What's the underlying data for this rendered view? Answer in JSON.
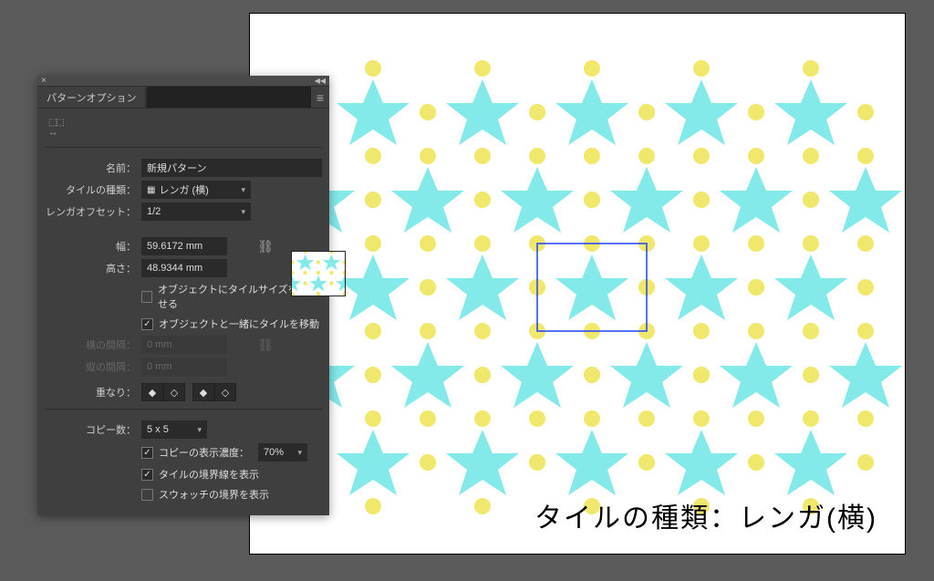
{
  "panel": {
    "title": "パターンオプション",
    "name_label": "名前：",
    "name_value": "新規パターン",
    "tiletype_label": "タイルの種類：",
    "tiletype_value": "レンガ (横)",
    "offset_label": "レンガオフセット：",
    "offset_value": "1/2",
    "width_label": "幅：",
    "width_value": "59.6172 mm",
    "height_label": "高さ：",
    "height_value": "48.9344 mm",
    "chk_size_label": "オブジェクトにタイルサイズを合わせる",
    "chk_move_label": "オブジェクトと一緒にタイルを移動",
    "hspacing_label": "横の間隔：",
    "hspacing_value": "0 mm",
    "vspacing_label": "縦の間隔：",
    "vspacing_value": "0 mm",
    "overlap_label": "重なり：",
    "copies_label": "コピー数：",
    "copies_value": "5 x 5",
    "dim_label": "コピーの表示濃度：",
    "dim_value": "70%",
    "chk_tileedge_label": "タイルの境界線を表示",
    "chk_swatch_label": "スウォッチの境界を表示"
  },
  "canvas": {
    "caption": "タイルの種類：レンガ(横)",
    "colors": {
      "star": "#83e9e9",
      "dot": "#f0e76d",
      "tilebox": "#2040ff"
    }
  }
}
